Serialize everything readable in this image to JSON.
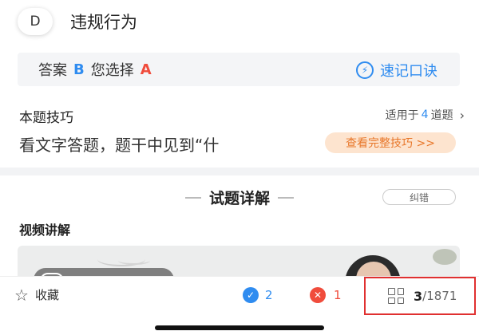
{
  "option": {
    "letter": "D",
    "text": "违规行为"
  },
  "answer": {
    "label": "答案",
    "correct": "B",
    "chosen_label": "您选择",
    "chosen": "A",
    "memo_label": "速记口诀",
    "memo_icon": "lightning-bulb-icon"
  },
  "tips": {
    "title": "本题技巧",
    "scope_prefix": "适用于",
    "scope_count": "4",
    "scope_suffix": "道题",
    "body": "看文字答题，题干中见到“什",
    "button_label": "查看完整技巧 >>"
  },
  "detail": {
    "title": "试题详解",
    "report_label": "纠错",
    "video_label": "视频讲解"
  },
  "bottom": {
    "favorite_label": "收藏",
    "correct_count": "2",
    "wrong_count": "1",
    "current": "3",
    "total": "/1871"
  },
  "colors": {
    "accent": "#2f8cf0",
    "wrong": "#f04c3c",
    "highlight_border": "#e03030",
    "tips_button_bg": "#fde4cf",
    "tips_button_text": "#e8772a"
  }
}
